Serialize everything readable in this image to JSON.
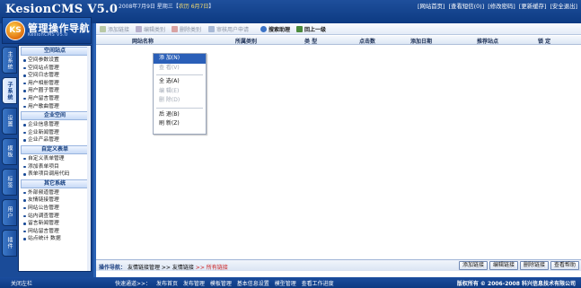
{
  "header": {
    "brand": "KesionCMS V5.0",
    "date": "2008年7月9日 星期三【",
    "lunar": "农历 6月7日",
    "date_end": "】",
    "links": [
      "[网站首页]",
      "[查看短信(0)]",
      "[修改密码]",
      "[更新缓存]",
      "[安全退出]"
    ]
  },
  "sidebar": {
    "logo_badge": "KS",
    "logo_title": "管理操作导航",
    "logo_sub": "KesionCMS V5.0",
    "tabs": [
      "主系统",
      "子系统",
      "设置",
      "模板",
      "标签",
      "用户",
      "插件"
    ],
    "active_tab": 1,
    "groups": [
      {
        "title": "空间站点",
        "items": [
          "空间参数设置",
          "空间站点管理",
          "空间日志管理",
          "用户相册管理",
          "用户圈子管理",
          "用户留言管理",
          "用户歌曲管理"
        ]
      },
      {
        "title": "企业空间",
        "items": [
          "企业信息管理",
          "企业新闻管理",
          "企业产品管理"
        ]
      },
      {
        "title": "自定义表单",
        "items": [
          "自定义表单管理",
          "添加表单项目",
          "表单项目调用代码"
        ]
      },
      {
        "title": "其它系统",
        "items": [
          "外部频道管理",
          "友情链接管理",
          "网站公告管理",
          "站内调查管理",
          "留言新闻管理",
          "网站留言管理",
          "站点统计 数据"
        ]
      }
    ]
  },
  "toolbar": [
    {
      "label": "添加链接",
      "enabled": false,
      "icon": "add-icon"
    },
    {
      "label": "编辑类别",
      "enabled": false,
      "icon": "edit-icon"
    },
    {
      "label": "删除类别",
      "enabled": false,
      "icon": "delete-icon"
    },
    {
      "label": "审核用户申请",
      "enabled": false,
      "icon": "verify-icon"
    },
    {
      "label": "搜索助理",
      "enabled": true,
      "icon": "search-icon"
    },
    {
      "label": "回上一级",
      "enabled": true,
      "icon": "back-icon"
    }
  ],
  "table": {
    "columns": [
      "网站名称",
      "所属类别",
      "类 型",
      "点击数",
      "添加日期",
      "推荐站点",
      "锁 定"
    ]
  },
  "context_menu": {
    "groups": [
      [
        {
          "label": "添 加(N)",
          "state": "selected"
        },
        {
          "label": "查 看(V)",
          "state": "disabled"
        }
      ],
      [
        {
          "label": "全 选(A)",
          "state": "normal"
        },
        {
          "label": "编 辑(E)",
          "state": "disabled"
        },
        {
          "label": "删 除(D)",
          "state": "disabled"
        }
      ],
      [
        {
          "label": "后 退(B)",
          "state": "normal"
        },
        {
          "label": "刷 新(Z)",
          "state": "normal"
        }
      ]
    ]
  },
  "bottom": {
    "nav_label": "操作导航：",
    "crumbs": [
      "友情链接管理",
      "友情链接"
    ],
    "current": "所有链接",
    "sep": ">>",
    "buttons": [
      "添加链接",
      "编辑链接",
      "删除链接",
      "查看帮助"
    ]
  },
  "footer": {
    "close": "关闭左栏",
    "quick_label": "快速通道>>：",
    "quick_links": [
      "发布首页",
      "发布管理",
      "模板管理",
      "基本信息设置",
      "模型管理",
      "查看工作进度"
    ],
    "copyright": "版权所有 © 2006-2008 科兴信息技术有限公司"
  },
  "colors": {
    "header": "#1e4f9c",
    "accent": "#2a5fb8",
    "current_crumb": "#cc1f1f"
  }
}
